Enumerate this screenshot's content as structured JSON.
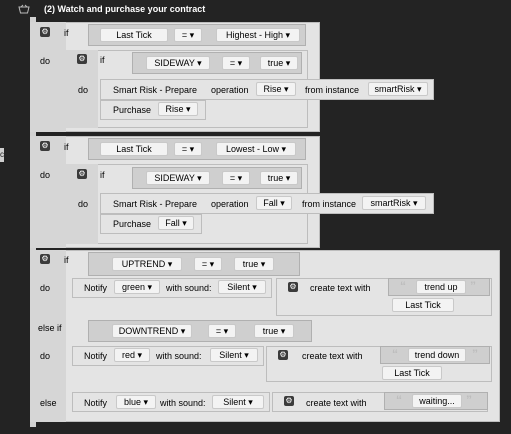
{
  "header": {
    "title": "(2) Watch and purchase your contract"
  },
  "kw": {
    "if": "if",
    "do": "do",
    "else_if": "else if",
    "else": "else"
  },
  "icons": {
    "basket": "basket-icon",
    "gear": "gear-icon",
    "quote_open": "“",
    "quote_close": "”"
  },
  "op": {
    "eq": "= ▾"
  },
  "b1": {
    "tick": "Last Tick",
    "value": "Highest - High ▾",
    "sideway": "SIDEWAY ▾",
    "true": "true ▾",
    "smart": "Smart Risk - Prepare",
    "operation": "operation",
    "dir": "Rise ▾",
    "from": "from instance",
    "instance": "smartRisk ▾",
    "purchase": "Purchase",
    "purchase_dir": "Rise ▾"
  },
  "b2": {
    "tick": "Last Tick",
    "value": "Lowest - Low ▾",
    "sideway": "SIDEWAY ▾",
    "true": "true ▾",
    "smart": "Smart Risk - Prepare",
    "operation": "operation",
    "dir": "Fall ▾",
    "from": "from instance",
    "instance": "smartRisk ▾",
    "purchase": "Purchase",
    "purchase_dir": "Fall ▾"
  },
  "b3": {
    "trend1": "UPTREND ▾",
    "true1": "true ▾",
    "notify1": "Notify",
    "color1": "green ▾",
    "sound_label": "with sound:",
    "sound1": "Silent ▾",
    "create": "create text with",
    "text1": "trend up",
    "lt1": "Last Tick",
    "trend2": "DOWNTREND ▾",
    "true2": "true ▾",
    "color2": "red ▾",
    "sound2": "Silent ▾",
    "text2": "trend down",
    "lt2": "Last Tick",
    "color3": "blue ▾",
    "sound3": "Silent ▾",
    "text3": "waiting..."
  },
  "side_marker": "c"
}
